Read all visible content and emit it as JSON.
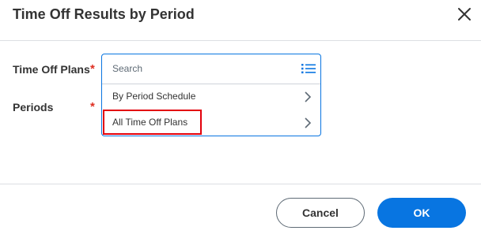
{
  "dialog": {
    "title": "Time Off Results by Period",
    "close_icon": "close-icon"
  },
  "form": {
    "time_off_plans": {
      "label": "Time Off Plans",
      "required_marker": "*",
      "search_placeholder": "Search",
      "list_icon": "list-icon",
      "options": [
        {
          "label": "By Period Schedule",
          "icon": "chevron-right-icon"
        },
        {
          "label": "All Time Off Plans",
          "icon": "chevron-right-icon"
        }
      ]
    },
    "periods": {
      "label": "Periods",
      "required_marker": "*"
    }
  },
  "footer": {
    "cancel_label": "Cancel",
    "ok_label": "OK"
  },
  "colors": {
    "accent": "#0875e1",
    "required": "#de2e21",
    "highlight": "#e3000b"
  }
}
